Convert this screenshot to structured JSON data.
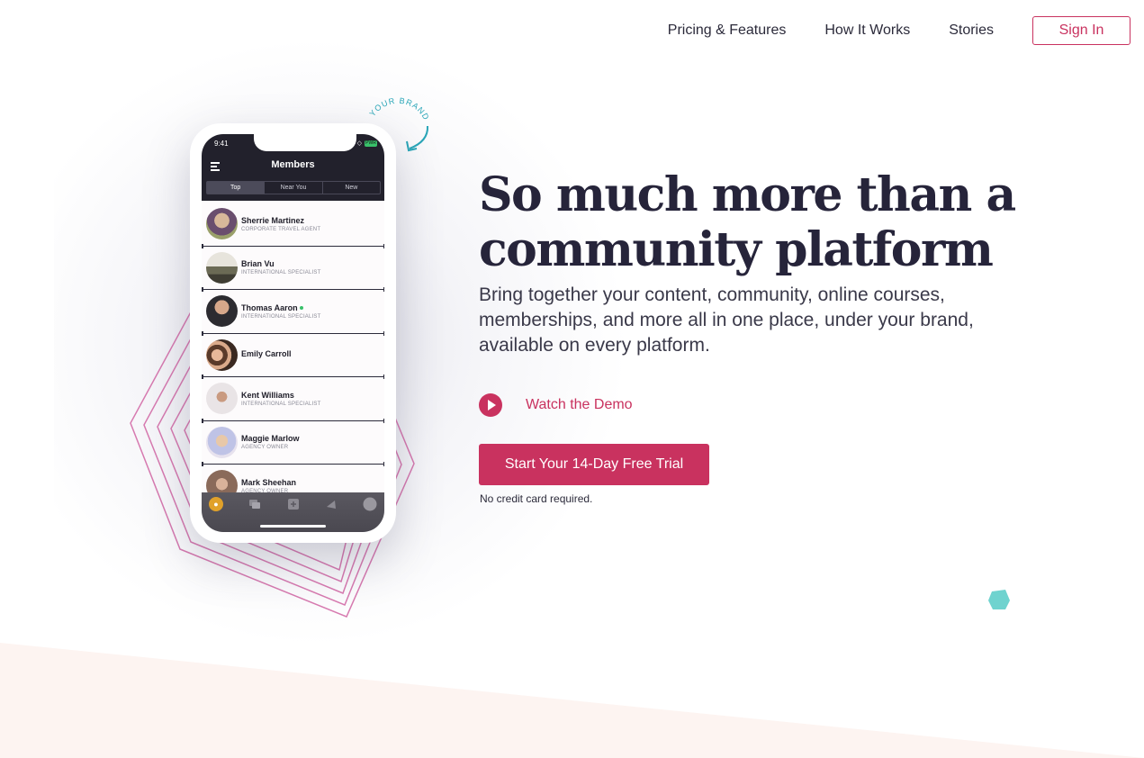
{
  "nav": {
    "links": [
      "Pricing & Features",
      "How It Works",
      "Stories"
    ],
    "sign_in": "Sign In"
  },
  "phone": {
    "status_time": "9:41",
    "battery": "PWR",
    "app_title": "Members",
    "tabs": [
      "Top",
      "Near You",
      "New"
    ],
    "active_tab": "Top",
    "members": [
      {
        "name": "Sherrie Martinez",
        "role": "CORPORATE TRAVEL AGENT",
        "online": false
      },
      {
        "name": "Brian Vu",
        "role": "INTERNATIONAL SPECIALIST",
        "online": false
      },
      {
        "name": "Thomas Aaron",
        "role": "INTERNATIONAL SPECIALIST",
        "online": true
      },
      {
        "name": "Emily Carroll",
        "role": "",
        "online": false
      },
      {
        "name": "Kent Williams",
        "role": "INTERNATIONAL SPECIALIST",
        "online": false
      },
      {
        "name": "Maggie Marlow",
        "role": "AGENCY OWNER",
        "online": false
      },
      {
        "name": "Mark Sheehan",
        "role": "AGENCY OWNER",
        "online": false
      }
    ],
    "brand_badge": "YOUR BRAND HERE"
  },
  "hero": {
    "headline_line1": "So much more than a",
    "headline_line2": "community platform",
    "subhead": "Bring together your content, community, online courses, memberships, and more all in one place, under your brand, available on every platform.",
    "demo_label": "Watch the Demo",
    "cta_label": "Start Your 14-Day Free Trial",
    "note": "No credit card required."
  },
  "colors": {
    "accent": "#c9325f",
    "dark": "#26243a",
    "teal": "#6fd3cf",
    "hex_stroke": "#e07ab0"
  }
}
